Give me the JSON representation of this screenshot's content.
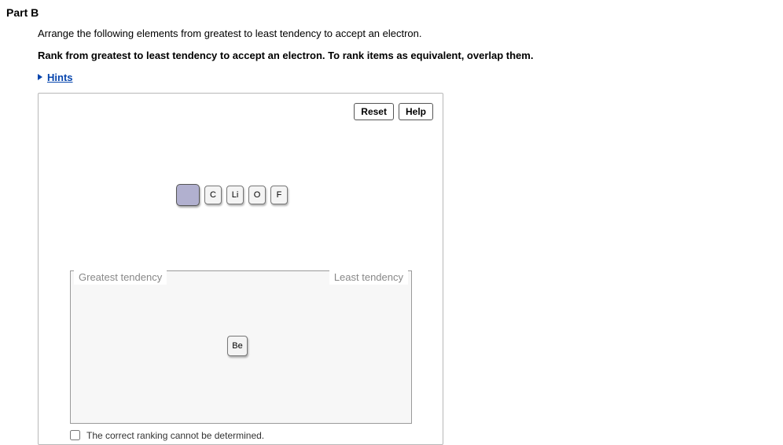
{
  "part_title": "Part B",
  "instruction": "Arrange the following elements from greatest to least tendency to accept an electron.",
  "instruction_bold": "Rank from greatest to least tendency to accept an electron. To rank items as equivalent, overlap them.",
  "hints_label": "Hints",
  "toolbar": {
    "reset": "Reset",
    "help": "Help"
  },
  "staging_elements": [
    "C",
    "Li",
    "O",
    "F"
  ],
  "ranking": {
    "left_label": "Greatest tendency",
    "right_label": "Least tendency",
    "placed": [
      "Be"
    ]
  },
  "cannot_determine_label": "The correct ranking cannot be determined."
}
